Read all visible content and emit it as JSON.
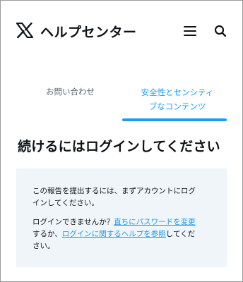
{
  "header": {
    "logo_icon": "x-logo-icon",
    "title": "ヘルプセンター",
    "menu_icon": "hamburger-menu-icon",
    "search_icon": "search-icon"
  },
  "tabs": [
    {
      "label": "お問い合わせ",
      "active": false
    },
    {
      "label_line1": "安全性とセンシティ",
      "label_line2": "ブなコンテンツ",
      "active": true
    }
  ],
  "main": {
    "heading": "続けるにはログインしてください",
    "info": {
      "p1_line1": "この報告を提出するには、まずアカウントにログ",
      "p1_line2": "インしてください。",
      "p2_prefix": "ログインできませんか？",
      "p2_link1": "直ちにパスワードを変更",
      "p2_mid": "するか、",
      "p2_link2": "ログインに関するヘルプを参照",
      "p2_suffix1": "してくだ",
      "p2_suffix2": "さい。"
    }
  },
  "colors": {
    "accent": "#1d9bf0",
    "info_bg": "#f0f5fa",
    "muted_text": "#536471",
    "text": "#0f1419"
  }
}
